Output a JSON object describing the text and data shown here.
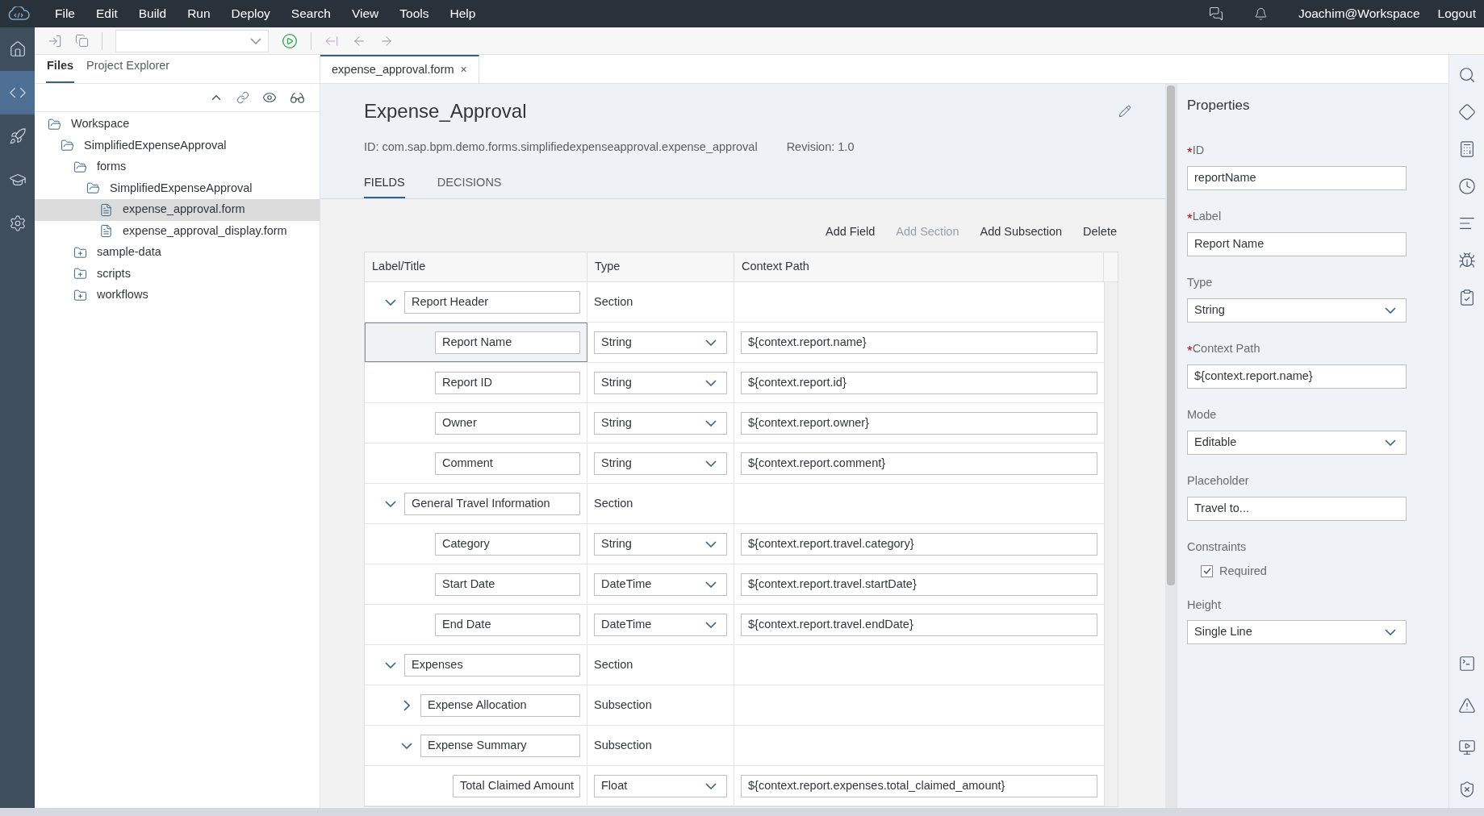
{
  "menu": [
    "File",
    "Edit",
    "Build",
    "Run",
    "Deploy",
    "Search",
    "View",
    "Tools",
    "Help"
  ],
  "user": "Joachim@Workspace",
  "logout": "Logout",
  "rail": [
    {
      "selected": false
    },
    {
      "selected": true
    },
    {
      "selected": false
    },
    {
      "selected": false
    },
    {
      "selected": false
    }
  ],
  "panel_tabs": [
    {
      "label": "Files",
      "selected": true
    },
    {
      "label": "Project Explorer",
      "selected": false
    }
  ],
  "tree": [
    {
      "kind": "folder",
      "name": "Workspace",
      "expanded": true,
      "selected": false,
      "children": [
        {
          "kind": "folder",
          "name": "SimplifiedExpenseApproval",
          "expanded": true,
          "selected": false,
          "children": [
            {
              "kind": "folder",
              "name": "forms",
              "expanded": true,
              "selected": false,
              "children": [
                {
                  "kind": "folder",
                  "name": "SimplifiedExpenseApproval",
                  "expanded": true,
                  "selected": false,
                  "children": [
                    {
                      "kind": "file",
                      "name": "expense_approval.form",
                      "selected": true
                    },
                    {
                      "kind": "file",
                      "name": "expense_approval_display.form",
                      "selected": false
                    }
                  ]
                }
              ]
            },
            {
              "kind": "folder",
              "name": "sample-data",
              "expanded": false,
              "selected": false
            },
            {
              "kind": "folder",
              "name": "scripts",
              "expanded": false,
              "selected": false
            },
            {
              "kind": "folder",
              "name": "workflows",
              "expanded": false,
              "selected": false
            }
          ]
        }
      ]
    }
  ],
  "editor_tab": {
    "label": "expense_approval.form",
    "close": "×"
  },
  "form": {
    "title": "Expense_Approval",
    "id": "ID: com.sap.bpm.demo.forms.simplifiedexpenseapproval.expense_approval",
    "revision": "Revision: 1.0"
  },
  "form_tabs": [
    {
      "label": "FIELDS",
      "selected": true
    },
    {
      "label": "DECISIONS",
      "selected": false
    }
  ],
  "actions": [
    {
      "label": "Add Field",
      "disabled": false
    },
    {
      "label": "Add Section",
      "disabled": true
    },
    {
      "label": "Add Subsection",
      "disabled": false
    },
    {
      "label": "Delete",
      "disabled": false
    }
  ],
  "columns": [
    "Label/Title",
    "Type",
    "Context Path"
  ],
  "rows": [
    {
      "kind": "section",
      "label": "Report Header",
      "type": "Section",
      "expanded": true,
      "children": [
        {
          "kind": "field",
          "label": "Report Name",
          "type": "String",
          "path": "${context.report.name}",
          "selected": true
        },
        {
          "kind": "field",
          "label": "Report ID",
          "type": "String",
          "path": "${context.report.id}",
          "selected": false
        },
        {
          "kind": "field",
          "label": "Owner",
          "type": "String",
          "path": "${context.report.owner}",
          "selected": false
        },
        {
          "kind": "field",
          "label": "Comment",
          "type": "String",
          "path": "${context.report.comment}",
          "selected": false
        }
      ]
    },
    {
      "kind": "section",
      "label": "General Travel Information",
      "type": "Section",
      "expanded": true,
      "children": [
        {
          "kind": "field",
          "label": "Category",
          "type": "String",
          "path": "${context.report.travel.category}",
          "selected": false
        },
        {
          "kind": "field",
          "label": "Start Date",
          "type": "DateTime",
          "path": "${context.report.travel.startDate}",
          "selected": false
        },
        {
          "kind": "field",
          "label": "End Date",
          "type": "DateTime",
          "path": "${context.report.travel.endDate}",
          "selected": false
        }
      ]
    },
    {
      "kind": "section",
      "label": "Expenses",
      "type": "Section",
      "expanded": true,
      "children": [
        {
          "kind": "subsection",
          "label": "Expense Allocation",
          "type": "Subsection",
          "expanded": false
        },
        {
          "kind": "subsection",
          "label": "Expense Summary",
          "type": "Subsection",
          "expanded": true,
          "children": [
            {
              "kind": "field",
              "label": "Total Claimed Amount",
              "type": "Float",
              "path": "${context.report.expenses.total_claimed_amount}",
              "selected": false
            }
          ]
        }
      ]
    }
  ],
  "properties": {
    "title": "Properties",
    "items": [
      {
        "kind": "input",
        "label": "ID",
        "marker": "*",
        "value": "reportName"
      },
      {
        "kind": "input",
        "label": "Label",
        "marker": "*",
        "value": "Report Name"
      },
      {
        "kind": "select",
        "label": "Type",
        "value": "String"
      },
      {
        "kind": "input",
        "label": "Context Path",
        "marker": "*",
        "value": "${context.report.name}"
      },
      {
        "kind": "select",
        "label": "Mode",
        "value": "Editable"
      },
      {
        "kind": "input",
        "label": "Placeholder",
        "value": "Travel to..."
      },
      {
        "kind": "checkbox",
        "label": "Constraints",
        "option": "Required",
        "checked": true
      },
      {
        "kind": "select",
        "label": "Height",
        "value": "Single Line"
      }
    ]
  }
}
